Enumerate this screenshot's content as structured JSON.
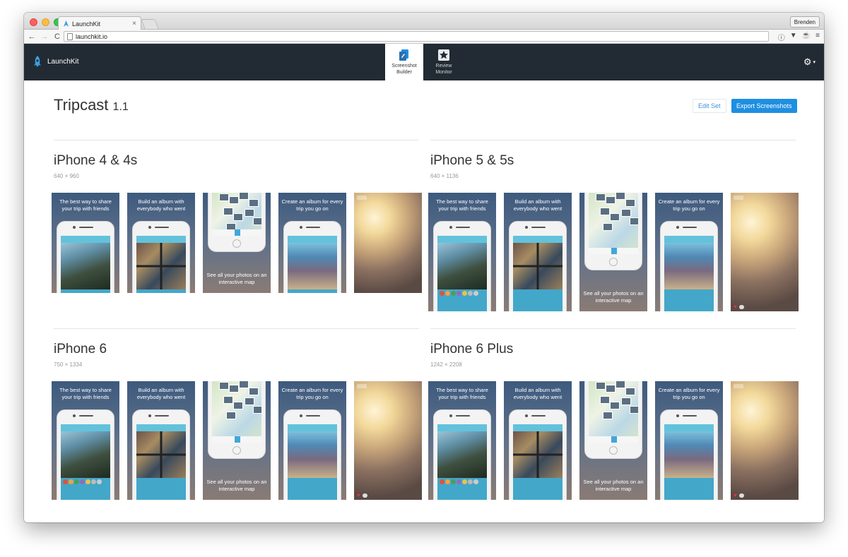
{
  "browser": {
    "tab_title": "LaunchKit",
    "tab_close": "×",
    "profile_name": "Brenden",
    "url": "launchkit.io",
    "back": "←",
    "forward": "→",
    "reload": "C",
    "icons": [
      "info-icon",
      "pocket-icon",
      "extension-icon",
      "menu-icon"
    ],
    "icon_glyphs": {
      "info": "ⓘ",
      "pocket": "▼",
      "extension": "☕",
      "menu": "≡"
    }
  },
  "navbar": {
    "brand": "LaunchKit",
    "tabs": [
      {
        "line1": "Screenshot",
        "line2": "Builder",
        "active": true
      },
      {
        "line1": "Review",
        "line2": "Monitor",
        "active": false
      }
    ],
    "settings_glyph": "⚙",
    "settings_caret": "▾"
  },
  "page": {
    "title": "Tripcast",
    "version": "1.1",
    "edit_button": "Edit Set",
    "export_button": "Export Screenshots"
  },
  "devices": [
    {
      "name": "iPhone 4 & 4s",
      "size": "640 × 960"
    },
    {
      "name": "iPhone 5 & 5s",
      "size": "640 × 1136"
    },
    {
      "name": "iPhone 6",
      "size": "750 × 1334"
    },
    {
      "name": "iPhone 6 Plus",
      "size": "1242 × 2208"
    }
  ],
  "captions": {
    "share": "The best way to share your trip with friends",
    "album": "Build an album with everybody who went",
    "map": "See all your photos on an interactive map",
    "trip": "Create an album for every trip you go on"
  },
  "colors": {
    "navbar_bg": "#222b33",
    "accent_blue": "#1e8fe1",
    "link_blue": "#3f8fd9"
  }
}
